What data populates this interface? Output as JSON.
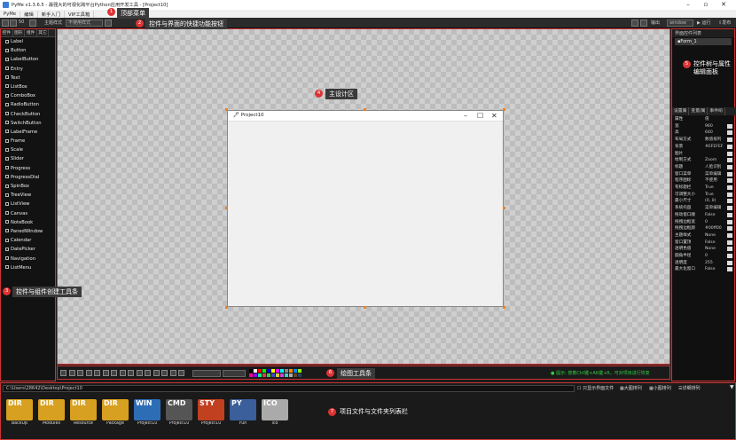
{
  "window": {
    "title": "PyMe v1.3.6.5 - 最强大的可视化跨平台Python应用开发工具 - [Project10]"
  },
  "menu": {
    "items": [
      "PyMe",
      "编辑",
      "新手入门",
      "VIP工具箱"
    ]
  },
  "toolbar": {
    "zoom": "50",
    "theme_label": "主题样式",
    "style_value": "不使用样式",
    "output_label": "输出",
    "platform_value": "window",
    "run_label": "运行",
    "publish_label": "发布"
  },
  "left_panel": {
    "tabs": [
      "控件",
      "图形",
      "组件",
      "其它"
    ],
    "widgets": [
      "Label",
      "Button",
      "LabelButton",
      "Entry",
      "Text",
      "ListBox",
      "ComboBox",
      "RadioButton",
      "CheckButton",
      "SwitchButton",
      "LabelFrame",
      "Frame",
      "Scale",
      "Slider",
      "Progress",
      "ProgressDial",
      "SpinBox",
      "TreeView",
      "ListView",
      "Canvas",
      "NoteBook",
      "PanedWindow",
      "Calendar",
      "DatePicker",
      "Navigation",
      "ListMenu"
    ]
  },
  "design_form": {
    "title": "Project10"
  },
  "draw_toolbar": {
    "tip": "提示: 按着Ctrl键+Alt键+R，可对项目进行恢复"
  },
  "right_panel": {
    "tree_title": "界面控件列表",
    "tree_items": [
      "Form_1"
    ],
    "tabs": [
      "设置属",
      "变量/属",
      "事件响"
    ],
    "properties": [
      {
        "key": "属性",
        "value": "值"
      },
      {
        "key": "宽",
        "value": "960"
      },
      {
        "key": "高",
        "value": "640"
      },
      {
        "key": "布局方式",
        "value": "数值排列"
      },
      {
        "key": "背景",
        "value": "#EFEFEF"
      },
      {
        "key": "图片",
        "value": ""
      },
      {
        "key": "绘制方式",
        "value": "Zoom"
      },
      {
        "key": "标题",
        "value": "人脸识别"
      },
      {
        "key": "窗口菜单",
        "value": "菜单编辑"
      },
      {
        "key": "程序图标",
        "value": "不使用"
      },
      {
        "key": "有标题栏",
        "value": "True"
      },
      {
        "key": "可调整大小",
        "value": "True"
      },
      {
        "key": "最小尺寸",
        "value": "(0, 0)"
      },
      {
        "key": "系统托盘",
        "value": "菜单编辑"
      },
      {
        "key": "拖动窗口顺",
        "value": "False"
      },
      {
        "key": "拖拽边框宽",
        "value": "0"
      },
      {
        "key": "拖拽边框颜",
        "value": "#00ff00"
      },
      {
        "key": "主题样式",
        "value": "None"
      },
      {
        "key": "窗口置顶",
        "value": "False"
      },
      {
        "key": "透明色值",
        "value": "None"
      },
      {
        "key": "圆角半径",
        "value": "0"
      },
      {
        "key": "透明度",
        "value": "255"
      },
      {
        "key": "最大化窗口",
        "value": "False"
      }
    ]
  },
  "bottom_panel": {
    "path": "C:\\Users\\28642\\Desktop\\Project10",
    "view_options": [
      "只显示界面文件",
      "大图排列",
      "小图排列",
      "详细排列"
    ],
    "files": [
      {
        "tag": "DIR",
        "label": "BackUp",
        "color": "#d8a020"
      },
      {
        "tag": "DIR",
        "label": "Modules",
        "color": "#d8a020"
      },
      {
        "tag": "DIR",
        "label": "Resource",
        "color": "#d8a020"
      },
      {
        "tag": "DIR",
        "label": "Package",
        "color": "#d8a020"
      },
      {
        "tag": "WIN",
        "label": "Project10",
        "color": "#2d6db5"
      },
      {
        "tag": "CMD",
        "label": "Project10",
        "color": "#555555"
      },
      {
        "tag": "STY",
        "label": "Project10",
        "color": "#c04020"
      },
      {
        "tag": "PY",
        "label": "Fun",
        "color": "#3a5f9a"
      },
      {
        "tag": "ICO",
        "label": "ico",
        "color": "#aaaaaa"
      }
    ]
  },
  "annotations": [
    {
      "num": "1",
      "label": "顶部菜单"
    },
    {
      "num": "2",
      "label": "控件与界面的快捷功能按钮"
    },
    {
      "num": "3",
      "label": "控件与组件创建工具条"
    },
    {
      "num": "4",
      "label": "主设计区"
    },
    {
      "num": "5",
      "label": "控件树与属性编辑面板"
    },
    {
      "num": "6",
      "label": "绘图工具条"
    },
    {
      "num": "7",
      "label": "项目文件与文件夹列表栏"
    }
  ],
  "colors": {
    "highlight_border": "#cc3333",
    "handle": "#f08020",
    "tip_text": "#2ecc40"
  }
}
